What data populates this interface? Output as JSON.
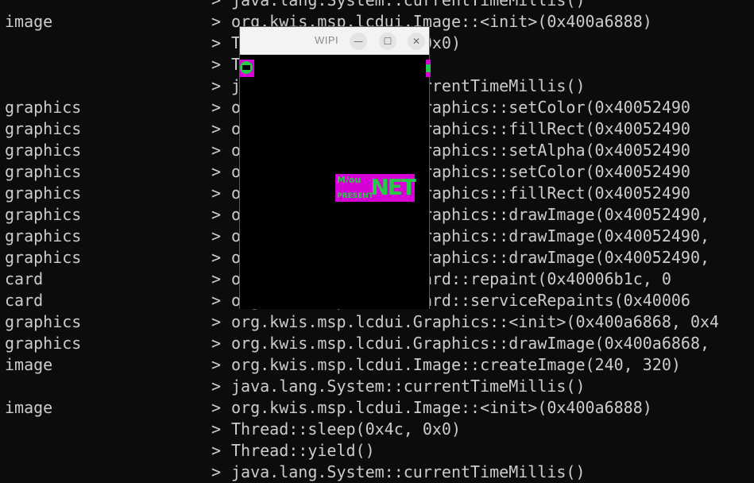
{
  "terminal": {
    "lines": [
      {
        "src": "",
        "msg": "java.lang.System::currentTimeMillis()"
      },
      {
        "src": "image",
        "msg": "org.kwis.msp.lcdui.Image::<init>(0x400a6888)"
      },
      {
        "src": "",
        "msg": "Thread::sleep(0x4c, 0x0)"
      },
      {
        "src": "",
        "msg": "Thread::yield()"
      },
      {
        "src": "",
        "msg": "java.lang.System::currentTimeMillis()"
      },
      {
        "src": "graphics",
        "msg": "org.kwis.msp.lcdui.Graphics::setColor(0x40052490"
      },
      {
        "src": "graphics",
        "msg": "org.kwis.msp.lcdui.Graphics::fillRect(0x40052490"
      },
      {
        "src": "graphics",
        "msg": "org.kwis.msp.lcdui.Graphics::setAlpha(0x40052490"
      },
      {
        "src": "graphics",
        "msg": "org.kwis.msp.lcdui.Graphics::setColor(0x40052490"
      },
      {
        "src": "graphics",
        "msg": "org.kwis.msp.lcdui.Graphics::fillRect(0x40052490"
      },
      {
        "src": "graphics",
        "msg": "org.kwis.msp.lcdui.Graphics::drawImage(0x40052490, "
      },
      {
        "src": "graphics",
        "msg": "org.kwis.msp.lcdui.Graphics::drawImage(0x40052490, "
      },
      {
        "src": "graphics",
        "msg": "org.kwis.msp.lcdui.Graphics::drawImage(0x40052490, "
      },
      {
        "src": "card",
        "msg": "org.kwis.msp.lcdui.Card::repaint(0x40006b1c, 0"
      },
      {
        "src": "card",
        "msg": "org.kwis.msp.lcdui.Card::serviceRepaints(0x40006"
      },
      {
        "src": "graphics",
        "msg": "org.kwis.msp.lcdui.Graphics::<init>(0x400a6868, 0x4"
      },
      {
        "src": "graphics",
        "msg": "org.kwis.msp.lcdui.Graphics::drawImage(0x400a6868, "
      },
      {
        "src": "image",
        "msg": "org.kwis.msp.lcdui.Image::createImage(240, 320)"
      },
      {
        "src": "",
        "msg": "java.lang.System::currentTimeMillis()"
      },
      {
        "src": "image",
        "msg": "org.kwis.msp.lcdui.Image::<init>(0x400a6888)"
      },
      {
        "src": "",
        "msg": "Thread::sleep(0x4c, 0x0)"
      },
      {
        "src": "",
        "msg": "Thread::yield()"
      },
      {
        "src": "",
        "msg": "java.lang.System::currentTimeMillis()"
      }
    ],
    "arrow": ">"
  },
  "window": {
    "title": "WIPI",
    "minimize_icon": "minimize-icon",
    "maximize_icon": "maximize-icon",
    "close_icon": "close-icon",
    "logo_big": "NET",
    "logo_small1": "M/ou",
    "logo_small2": "PRESENT",
    "colors": {
      "magenta": "#d600d6",
      "green": "#29c948"
    }
  }
}
